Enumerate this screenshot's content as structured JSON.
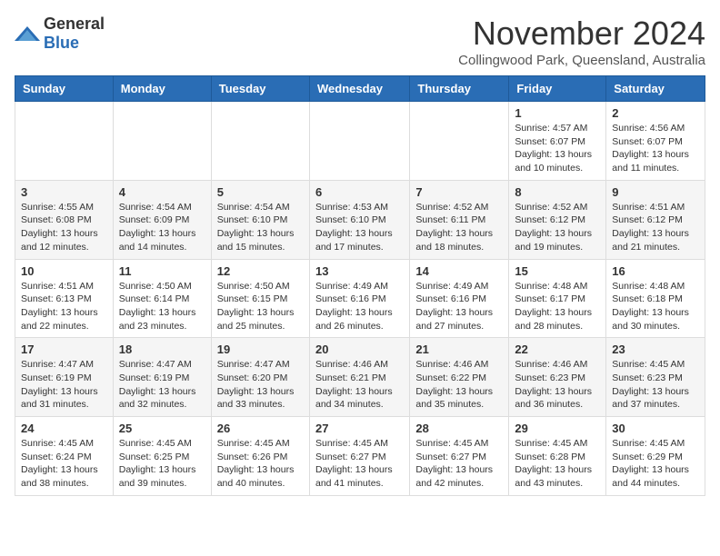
{
  "logo": {
    "general": "General",
    "blue": "Blue"
  },
  "header": {
    "month": "November 2024",
    "location": "Collingwood Park, Queensland, Australia"
  },
  "weekdays": [
    "Sunday",
    "Monday",
    "Tuesday",
    "Wednesday",
    "Thursday",
    "Friday",
    "Saturday"
  ],
  "weeks": [
    [
      {
        "day": "",
        "info": ""
      },
      {
        "day": "",
        "info": ""
      },
      {
        "day": "",
        "info": ""
      },
      {
        "day": "",
        "info": ""
      },
      {
        "day": "",
        "info": ""
      },
      {
        "day": "1",
        "info": "Sunrise: 4:57 AM\nSunset: 6:07 PM\nDaylight: 13 hours and 10 minutes."
      },
      {
        "day": "2",
        "info": "Sunrise: 4:56 AM\nSunset: 6:07 PM\nDaylight: 13 hours and 11 minutes."
      }
    ],
    [
      {
        "day": "3",
        "info": "Sunrise: 4:55 AM\nSunset: 6:08 PM\nDaylight: 13 hours and 12 minutes."
      },
      {
        "day": "4",
        "info": "Sunrise: 4:54 AM\nSunset: 6:09 PM\nDaylight: 13 hours and 14 minutes."
      },
      {
        "day": "5",
        "info": "Sunrise: 4:54 AM\nSunset: 6:10 PM\nDaylight: 13 hours and 15 minutes."
      },
      {
        "day": "6",
        "info": "Sunrise: 4:53 AM\nSunset: 6:10 PM\nDaylight: 13 hours and 17 minutes."
      },
      {
        "day": "7",
        "info": "Sunrise: 4:52 AM\nSunset: 6:11 PM\nDaylight: 13 hours and 18 minutes."
      },
      {
        "day": "8",
        "info": "Sunrise: 4:52 AM\nSunset: 6:12 PM\nDaylight: 13 hours and 19 minutes."
      },
      {
        "day": "9",
        "info": "Sunrise: 4:51 AM\nSunset: 6:12 PM\nDaylight: 13 hours and 21 minutes."
      }
    ],
    [
      {
        "day": "10",
        "info": "Sunrise: 4:51 AM\nSunset: 6:13 PM\nDaylight: 13 hours and 22 minutes."
      },
      {
        "day": "11",
        "info": "Sunrise: 4:50 AM\nSunset: 6:14 PM\nDaylight: 13 hours and 23 minutes."
      },
      {
        "day": "12",
        "info": "Sunrise: 4:50 AM\nSunset: 6:15 PM\nDaylight: 13 hours and 25 minutes."
      },
      {
        "day": "13",
        "info": "Sunrise: 4:49 AM\nSunset: 6:16 PM\nDaylight: 13 hours and 26 minutes."
      },
      {
        "day": "14",
        "info": "Sunrise: 4:49 AM\nSunset: 6:16 PM\nDaylight: 13 hours and 27 minutes."
      },
      {
        "day": "15",
        "info": "Sunrise: 4:48 AM\nSunset: 6:17 PM\nDaylight: 13 hours and 28 minutes."
      },
      {
        "day": "16",
        "info": "Sunrise: 4:48 AM\nSunset: 6:18 PM\nDaylight: 13 hours and 30 minutes."
      }
    ],
    [
      {
        "day": "17",
        "info": "Sunrise: 4:47 AM\nSunset: 6:19 PM\nDaylight: 13 hours and 31 minutes."
      },
      {
        "day": "18",
        "info": "Sunrise: 4:47 AM\nSunset: 6:19 PM\nDaylight: 13 hours and 32 minutes."
      },
      {
        "day": "19",
        "info": "Sunrise: 4:47 AM\nSunset: 6:20 PM\nDaylight: 13 hours and 33 minutes."
      },
      {
        "day": "20",
        "info": "Sunrise: 4:46 AM\nSunset: 6:21 PM\nDaylight: 13 hours and 34 minutes."
      },
      {
        "day": "21",
        "info": "Sunrise: 4:46 AM\nSunset: 6:22 PM\nDaylight: 13 hours and 35 minutes."
      },
      {
        "day": "22",
        "info": "Sunrise: 4:46 AM\nSunset: 6:23 PM\nDaylight: 13 hours and 36 minutes."
      },
      {
        "day": "23",
        "info": "Sunrise: 4:45 AM\nSunset: 6:23 PM\nDaylight: 13 hours and 37 minutes."
      }
    ],
    [
      {
        "day": "24",
        "info": "Sunrise: 4:45 AM\nSunset: 6:24 PM\nDaylight: 13 hours and 38 minutes."
      },
      {
        "day": "25",
        "info": "Sunrise: 4:45 AM\nSunset: 6:25 PM\nDaylight: 13 hours and 39 minutes."
      },
      {
        "day": "26",
        "info": "Sunrise: 4:45 AM\nSunset: 6:26 PM\nDaylight: 13 hours and 40 minutes."
      },
      {
        "day": "27",
        "info": "Sunrise: 4:45 AM\nSunset: 6:27 PM\nDaylight: 13 hours and 41 minutes."
      },
      {
        "day": "28",
        "info": "Sunrise: 4:45 AM\nSunset: 6:27 PM\nDaylight: 13 hours and 42 minutes."
      },
      {
        "day": "29",
        "info": "Sunrise: 4:45 AM\nSunset: 6:28 PM\nDaylight: 13 hours and 43 minutes."
      },
      {
        "day": "30",
        "info": "Sunrise: 4:45 AM\nSunset: 6:29 PM\nDaylight: 13 hours and 44 minutes."
      }
    ]
  ]
}
